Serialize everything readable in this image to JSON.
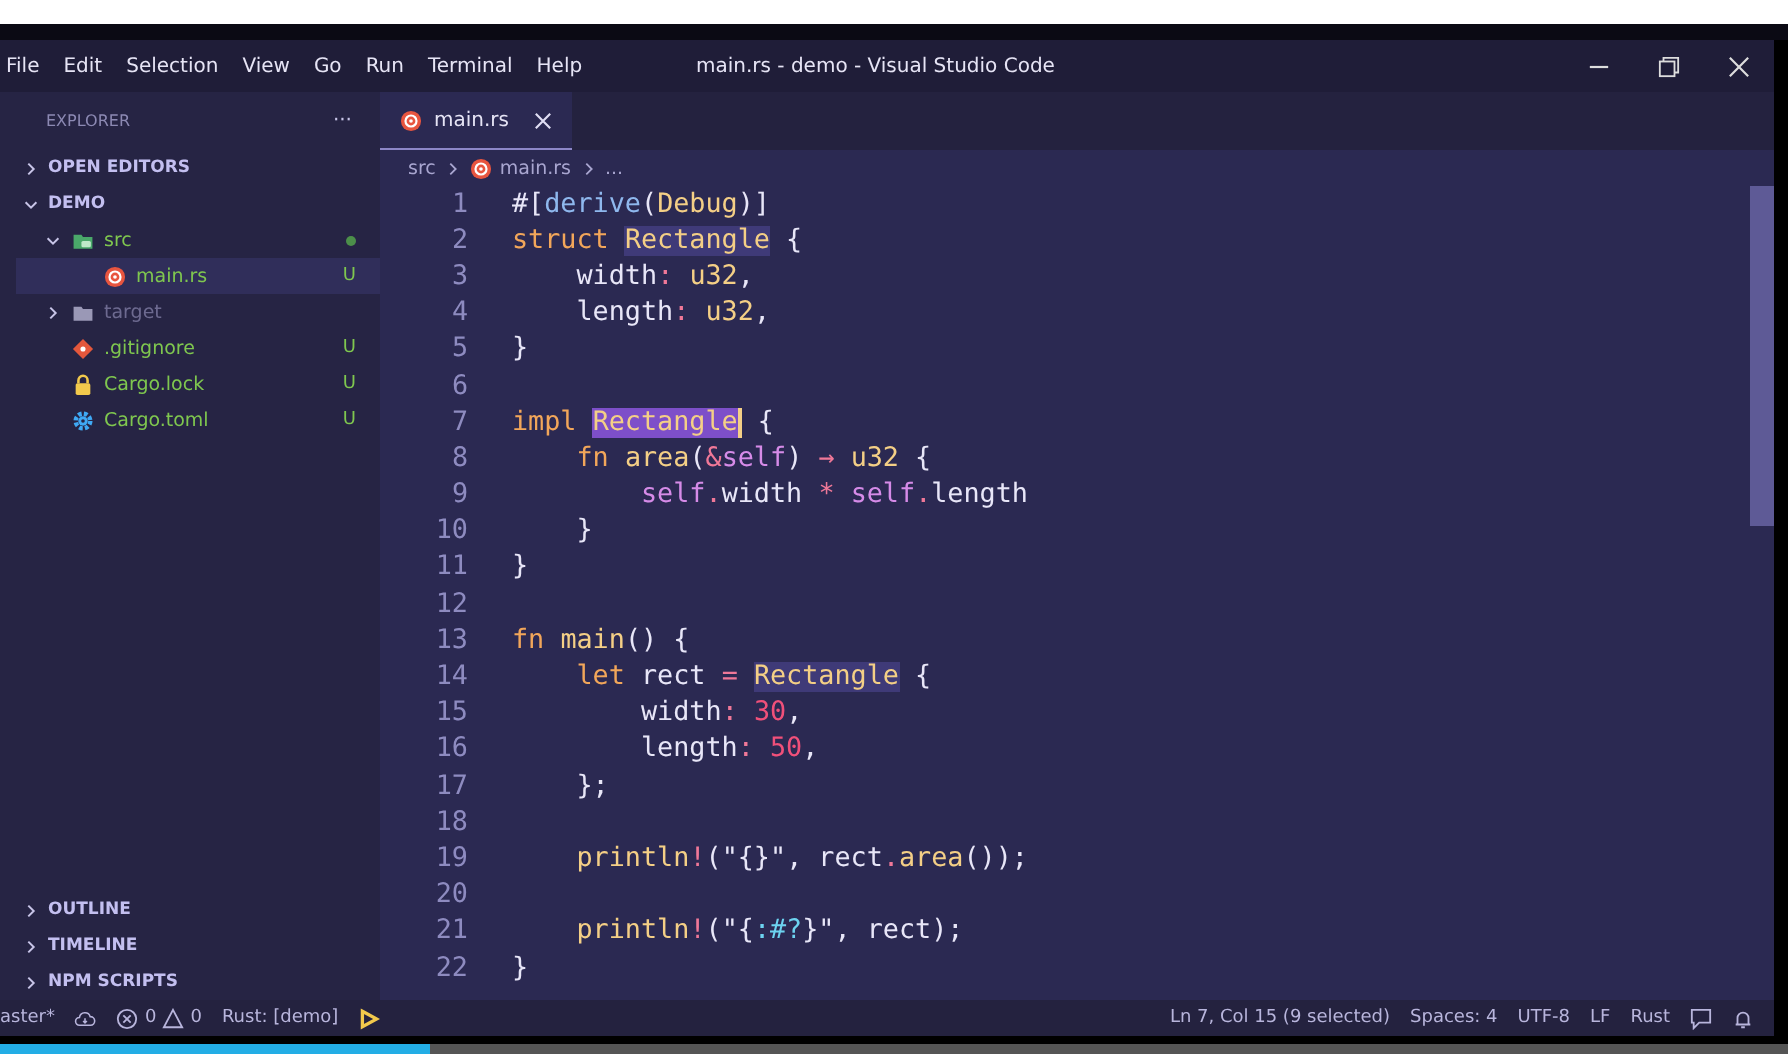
{
  "window": {
    "title": "main.rs - demo - Visual Studio Code"
  },
  "menu": [
    "File",
    "Edit",
    "Selection",
    "View",
    "Go",
    "Run",
    "Terminal",
    "Help"
  ],
  "sidebar": {
    "title": "EXPLORER",
    "more": "···",
    "sections_top": [
      {
        "label": "OPEN EDITORS",
        "expanded": false
      },
      {
        "label": "DEMO",
        "expanded": true
      }
    ],
    "tree": [
      {
        "name": "src",
        "kind": "folder-src",
        "expanded": true,
        "modified": true,
        "ignored": false,
        "selected": false,
        "children": [
          {
            "name": "main.rs",
            "kind": "rust",
            "badge": "U",
            "ignored": false,
            "selected": true
          }
        ]
      },
      {
        "name": "target",
        "kind": "folder",
        "expanded": false,
        "modified": false,
        "ignored": true,
        "selected": false
      },
      {
        "name": ".gitignore",
        "kind": "git",
        "badge": "U",
        "ignored": false,
        "selected": false
      },
      {
        "name": "Cargo.lock",
        "kind": "lock",
        "badge": "U",
        "ignored": false,
        "selected": false
      },
      {
        "name": "Cargo.toml",
        "kind": "config",
        "badge": "U",
        "ignored": false,
        "selected": false
      }
    ],
    "sections_bottom": [
      {
        "label": "OUTLINE",
        "expanded": false
      },
      {
        "label": "TIMELINE",
        "expanded": false
      },
      {
        "label": "NPM SCRIPTS",
        "expanded": false
      }
    ]
  },
  "tabs": [
    {
      "label": "main.rs",
      "selected": true
    }
  ],
  "breadcrumb": [
    "src",
    "main.rs",
    "..."
  ],
  "code": [
    {
      "number": "1",
      "tokens": [
        {
          "kind": "punct",
          "text": "#["
        },
        {
          "kind": "attr",
          "text": "derive"
        },
        {
          "kind": "punct",
          "text": "("
        },
        {
          "kind": "type",
          "text": "Debug"
        },
        {
          "kind": "punct",
          "text": ")]"
        }
      ]
    },
    {
      "number": "2",
      "tokens": [
        {
          "kind": "kw",
          "text": "struct "
        },
        {
          "kind": "type",
          "text": "Rectangle",
          "match_highlight": true
        },
        {
          "kind": "punct",
          "text": " {"
        }
      ]
    },
    {
      "number": "3",
      "tokens": [
        {
          "kind": "plain",
          "text": "    width"
        },
        {
          "kind": "op",
          "text": ": "
        },
        {
          "kind": "type",
          "text": "u32"
        },
        {
          "kind": "punct",
          "text": ","
        }
      ]
    },
    {
      "number": "4",
      "tokens": [
        {
          "kind": "plain",
          "text": "    length"
        },
        {
          "kind": "op",
          "text": ": "
        },
        {
          "kind": "type",
          "text": "u32"
        },
        {
          "kind": "punct",
          "text": ","
        }
      ]
    },
    {
      "number": "5",
      "tokens": [
        {
          "kind": "punct",
          "text": "}"
        }
      ]
    },
    {
      "number": "6"
    },
    {
      "number": "7",
      "tokens": [
        {
          "kind": "kw",
          "text": "impl "
        },
        {
          "kind": "type",
          "text": "Rectangle",
          "selection": true
        },
        {
          "kind": "punct",
          "text": " {"
        }
      ]
    },
    {
      "number": "8",
      "tokens": [
        {
          "kind": "kw",
          "text": "    fn "
        },
        {
          "kind": "fn",
          "text": "area"
        },
        {
          "kind": "punct",
          "text": "("
        },
        {
          "kind": "op",
          "text": "&"
        },
        {
          "kind": "self",
          "text": "self"
        },
        {
          "kind": "punct",
          "text": ") "
        },
        {
          "kind": "op",
          "text": "→ "
        },
        {
          "kind": "type",
          "text": "u32"
        },
        {
          "kind": "punct",
          "text": " {"
        }
      ]
    },
    {
      "number": "9",
      "tokens": [
        {
          "kind": "self",
          "text": "        self"
        },
        {
          "kind": "op",
          "text": "."
        },
        {
          "kind": "plain",
          "text": "width "
        },
        {
          "kind": "op",
          "text": "* "
        },
        {
          "kind": "self",
          "text": "self"
        },
        {
          "kind": "op",
          "text": "."
        },
        {
          "kind": "plain",
          "text": "length"
        }
      ]
    },
    {
      "number": "10",
      "tokens": [
        {
          "kind": "punct",
          "text": "    }"
        }
      ]
    },
    {
      "number": "11",
      "tokens": [
        {
          "kind": "punct",
          "text": "}"
        }
      ]
    },
    {
      "number": "12"
    },
    {
      "number": "13",
      "tokens": [
        {
          "kind": "kw",
          "text": "fn "
        },
        {
          "kind": "fn",
          "text": "main"
        },
        {
          "kind": "punct",
          "text": "() {"
        }
      ]
    },
    {
      "number": "14",
      "tokens": [
        {
          "kind": "kw",
          "text": "    let"
        },
        {
          "kind": "plain",
          "text": " rect "
        },
        {
          "kind": "op",
          "text": "= "
        },
        {
          "kind": "type",
          "text": "Rectangle",
          "match_highlight": true
        },
        {
          "kind": "punct",
          "text": " {"
        }
      ]
    },
    {
      "number": "15",
      "tokens": [
        {
          "kind": "plain",
          "text": "        width"
        },
        {
          "kind": "op",
          "text": ": "
        },
        {
          "kind": "num",
          "text": "30"
        },
        {
          "kind": "punct",
          "text": ","
        }
      ]
    },
    {
      "number": "16",
      "tokens": [
        {
          "kind": "plain",
          "text": "        length"
        },
        {
          "kind": "op",
          "text": ": "
        },
        {
          "kind": "num",
          "text": "50"
        },
        {
          "kind": "punct",
          "text": ","
        }
      ]
    },
    {
      "number": "17",
      "tokens": [
        {
          "kind": "punct",
          "text": "    };"
        }
      ]
    },
    {
      "number": "18"
    },
    {
      "number": "19",
      "tokens": [
        {
          "kind": "macro",
          "text": "    println"
        },
        {
          "kind": "op",
          "text": "!"
        },
        {
          "kind": "punct",
          "text": "("
        },
        {
          "kind": "str",
          "text": "\"{}\""
        },
        {
          "kind": "punct",
          "text": ", rect"
        },
        {
          "kind": "op",
          "text": "."
        },
        {
          "kind": "fn",
          "text": "area"
        },
        {
          "kind": "punct",
          "text": "());"
        }
      ]
    },
    {
      "number": "20"
    },
    {
      "number": "21",
      "tokens": [
        {
          "kind": "macro",
          "text": "    println"
        },
        {
          "kind": "op",
          "text": "!"
        },
        {
          "kind": "punct",
          "text": "("
        },
        {
          "kind": "str",
          "text": "\"{"
        },
        {
          "kind": "esc",
          "text": ":#?"
        },
        {
          "kind": "str",
          "text": "}\""
        },
        {
          "kind": "punct",
          "text": ", rect);"
        }
      ]
    },
    {
      "number": "22",
      "tokens": [
        {
          "kind": "punct",
          "text": "}"
        }
      ]
    }
  ],
  "status_bar": {
    "branch": "aster*",
    "errors": "0",
    "warnings": "0",
    "rust_status": "Rust: [demo]",
    "position": "Ln 7, Col 15 (9 selected)",
    "indentation": "Spaces: 4",
    "encoding": "UTF-8",
    "line_ending": "LF",
    "language": "Rust"
  },
  "video_progress": {
    "level": 0.24
  }
}
